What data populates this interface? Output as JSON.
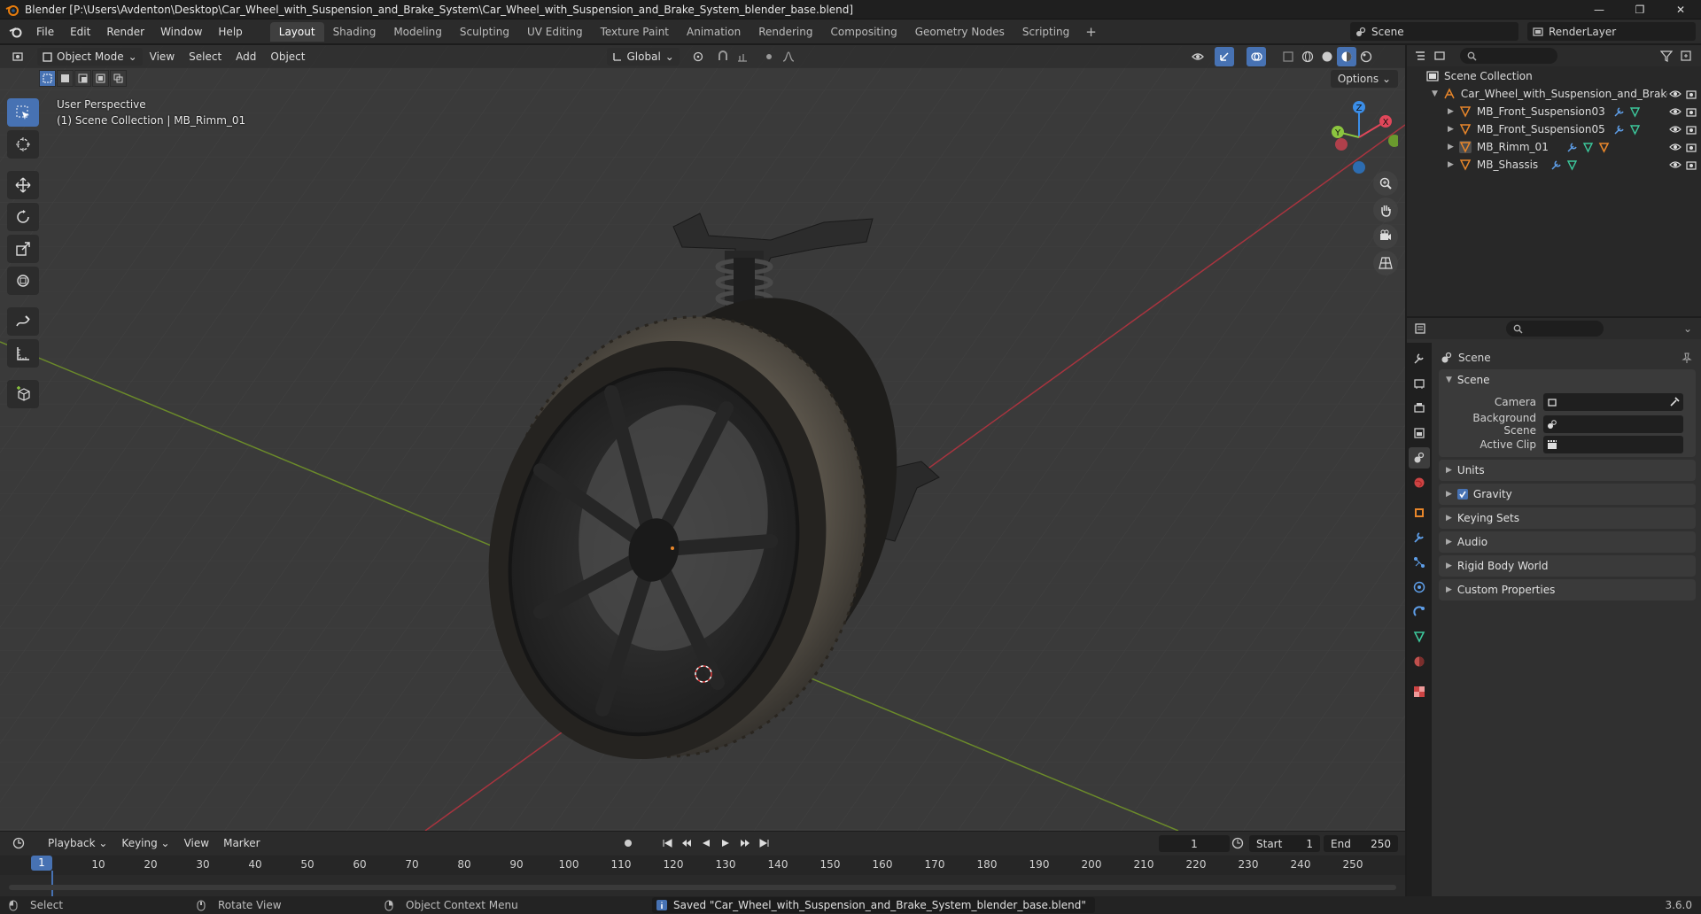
{
  "window": {
    "title": "Blender [P:\\Users\\Avdenton\\Desktop\\Car_Wheel_with_Suspension_and_Brake_System\\Car_Wheel_with_Suspension_and_Brake_System_blender_base.blend]",
    "minimize": "—",
    "restore": "❐",
    "close": "✕"
  },
  "menu": [
    "File",
    "Edit",
    "Render",
    "Window",
    "Help"
  ],
  "workspaces": [
    "Layout",
    "Shading",
    "Modeling",
    "Sculpting",
    "UV Editing",
    "Texture Paint",
    "Animation",
    "Rendering",
    "Compositing",
    "Geometry Nodes",
    "Scripting"
  ],
  "add_workspace": "+",
  "scene_selector": "Scene",
  "view_layer": "RenderLayer",
  "viewport": {
    "mode": "Object Mode",
    "menus": [
      "View",
      "Select",
      "Add",
      "Object"
    ],
    "transform_orientation": "Global",
    "options_label": "Options",
    "perspective": "User Perspective",
    "collection_info": "(1) Scene Collection | MB_Rimm_01",
    "gizmo_axes": {
      "x": "X",
      "y": "Y",
      "z": "Z"
    }
  },
  "outliner": {
    "root": "Scene Collection",
    "collection": "Car_Wheel_with_Suspension_and_Brake",
    "objects": [
      "MB_Front_Suspension03",
      "MB_Front_Suspension05",
      "MB_Rimm_01",
      "MB_Shassis"
    ]
  },
  "properties": {
    "context": "Scene",
    "panel_scene": "Scene",
    "camera_label": "Camera",
    "background_scene_label": "Background Scene",
    "active_clip_label": "Active Clip",
    "collapsed_panels": [
      "Units",
      "Gravity",
      "Keying Sets",
      "Audio",
      "Rigid Body World",
      "Custom Properties"
    ],
    "gravity_enabled": true
  },
  "timeline": {
    "menus": [
      "Playback",
      "Keying",
      "View",
      "Marker"
    ],
    "current_frame": "1",
    "start_label": "Start",
    "start": "1",
    "end_label": "End",
    "end": "250",
    "ticks": [
      "10",
      "20",
      "30",
      "40",
      "50",
      "60",
      "70",
      "80",
      "90",
      "100",
      "110",
      "120",
      "130",
      "140",
      "150",
      "160",
      "170",
      "180",
      "190",
      "200",
      "210",
      "220",
      "230",
      "240",
      "250"
    ],
    "cursor_frame": "1"
  },
  "statusbar": {
    "select": "Select",
    "rotate": "Rotate View",
    "context_menu": "Object Context Menu",
    "message": "Saved \"Car_Wheel_with_Suspension_and_Brake_System_blender_base.blend\"",
    "version": "3.6.0"
  },
  "colors": {
    "accent": "#4772b3",
    "x_axis": "#e0475a",
    "y_axis": "#8cc63f",
    "z_axis": "#3b8ee8",
    "object_orange": "#e8862a"
  }
}
